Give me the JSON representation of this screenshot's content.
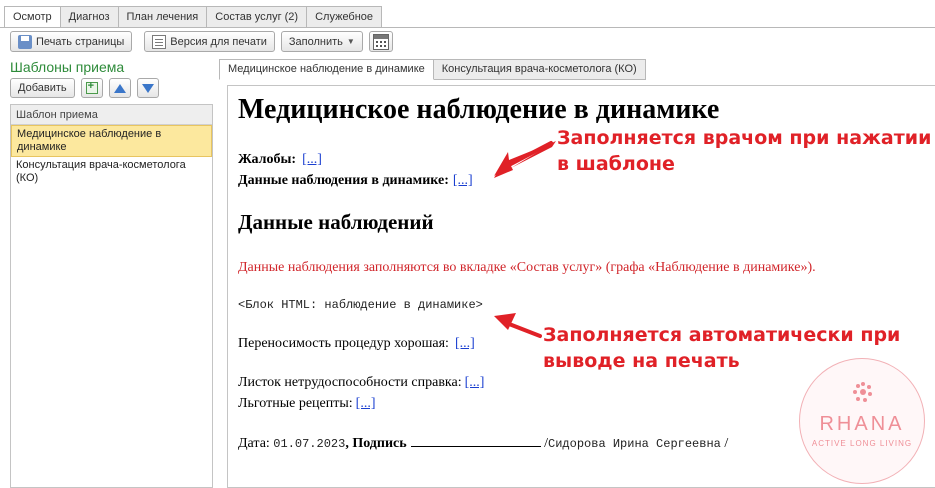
{
  "top_tabs": [
    {
      "label": "Осмотр",
      "active": true
    },
    {
      "label": "Диагноз",
      "active": false
    },
    {
      "label": "План лечения",
      "active": false
    },
    {
      "label": "Состав услуг (2)",
      "active": false
    },
    {
      "label": "Служебное",
      "active": false
    }
  ],
  "toolbar": {
    "print_page": "Печать страницы",
    "print_version": "Версия для печати",
    "fill": "Заполнить"
  },
  "templates": {
    "title": "Шаблоны приема",
    "add_label": "Добавить",
    "column_header": "Шаблон приема",
    "items": [
      {
        "label": "Медицинское наблюдение в динамике",
        "selected": true
      },
      {
        "label": "Консультация врача-косметолога (КО)",
        "selected": false
      }
    ]
  },
  "inner_tabs": [
    {
      "label": "Медицинское наблюдение в динамике",
      "active": true
    },
    {
      "label": "Консультация врача-косметолога (КО)",
      "active": false
    }
  ],
  "document": {
    "title": "Медицинское наблюдение в динамике",
    "complaints_label": "Жалобы:",
    "complaints_link": "[...]",
    "dynamics_label": "Данные наблюдения в динамике:",
    "dynamics_link": "[...]",
    "section_title": "Данные наблюдений",
    "section_note": "Данные наблюдения заполняются во вкладке «Состав услуг» (графа «Наблюдение в динамике»).",
    "html_block": "<Блок HTML: наблюдение в динамике>",
    "tolerance_label": "Переносимость процедур хорошая:",
    "tolerance_link": "[...]",
    "sick_leave_label": "Листок нетрудоспособности справка:",
    "sick_leave_link": "[...]",
    "prescriptions_label": "Льготные рецепты:",
    "prescriptions_link": "[...]",
    "date_label": "Дата:",
    "date_value": "01.07.2023",
    "signature_label": ", Подпись",
    "slash": "/",
    "doctor_name": "Сидорова Ирина Сергеевна"
  },
  "annotations": {
    "top_line1": "Заполняется врачом при нажатии",
    "top_line2": "в шаблоне",
    "bottom_line1": "Заполняется автоматически при",
    "bottom_line2": "выводе на печать"
  },
  "watermark": {
    "name": "RHANA",
    "tagline": "ACTIVE LONG LIVING"
  },
  "colors": {
    "annotation_red": "#e02127",
    "template_title_green": "#2e8b3a",
    "selected_row": "#fce89e",
    "link_blue": "#1a3fd0"
  }
}
